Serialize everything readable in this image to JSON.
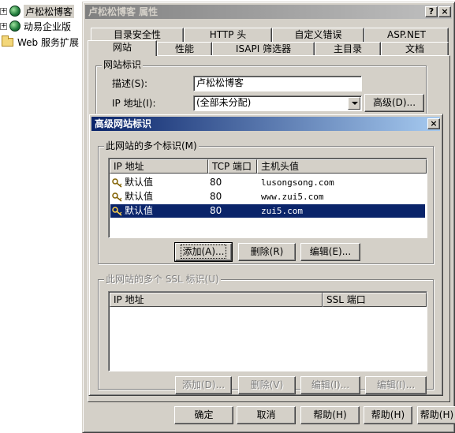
{
  "tree": {
    "items": [
      {
        "label": "卢松松博客"
      },
      {
        "label": "动易企业版"
      },
      {
        "label": "Web 服务扩展"
      }
    ]
  },
  "properties_dialog": {
    "title": "卢松松博客 属性",
    "help_button": "?",
    "close_button": "×",
    "tabs_row1": [
      "目录安全性",
      "HTTP 头",
      "自定义错误",
      "ASP.NET"
    ],
    "tabs_row2": [
      "网站",
      "性能",
      "ISAPI 筛选器",
      "主目录",
      "文档"
    ],
    "group_site_id": "网站标识",
    "description_label": "描述(S):",
    "description_value": "卢松松博客",
    "ip_label": "IP 地址(I):",
    "ip_value": "(全部未分配)",
    "advanced_button": "高级(D)...",
    "footer": {
      "ok": "确定",
      "cancel": "取消",
      "help": "帮助(H)"
    }
  },
  "advanced_dialog": {
    "title": "高级网站标识",
    "close_button": "×",
    "group_identities": "此网站的多个标识(M)",
    "columns": [
      "IP 地址",
      "TCP 端口",
      "主机头值"
    ],
    "rows": [
      {
        "ip": "默认值",
        "port": "80",
        "host": "lusongsong.com",
        "selected": false
      },
      {
        "ip": "默认值",
        "port": "80",
        "host": "www.zui5.com",
        "selected": false
      },
      {
        "ip": "默认值",
        "port": "80",
        "host": "zui5.com",
        "selected": true
      }
    ],
    "add_button": "添加(A)...",
    "remove_button": "删除(R)",
    "edit_button": "编辑(E)...",
    "group_ssl": "此网站的多个 SSL 标识(U)",
    "ssl_columns": [
      "IP 地址",
      "SSL 端口"
    ],
    "ssl_add_button": "添加(D)...",
    "ssl_remove_button": "删除(V)",
    "ssl_edit_button": "编辑(I)...",
    "ok_button": "确定",
    "cancel_button": "取消",
    "help_button": "帮助(H)"
  },
  "colors": {
    "selection": "#0a246a",
    "face": "#d4d0c8"
  }
}
